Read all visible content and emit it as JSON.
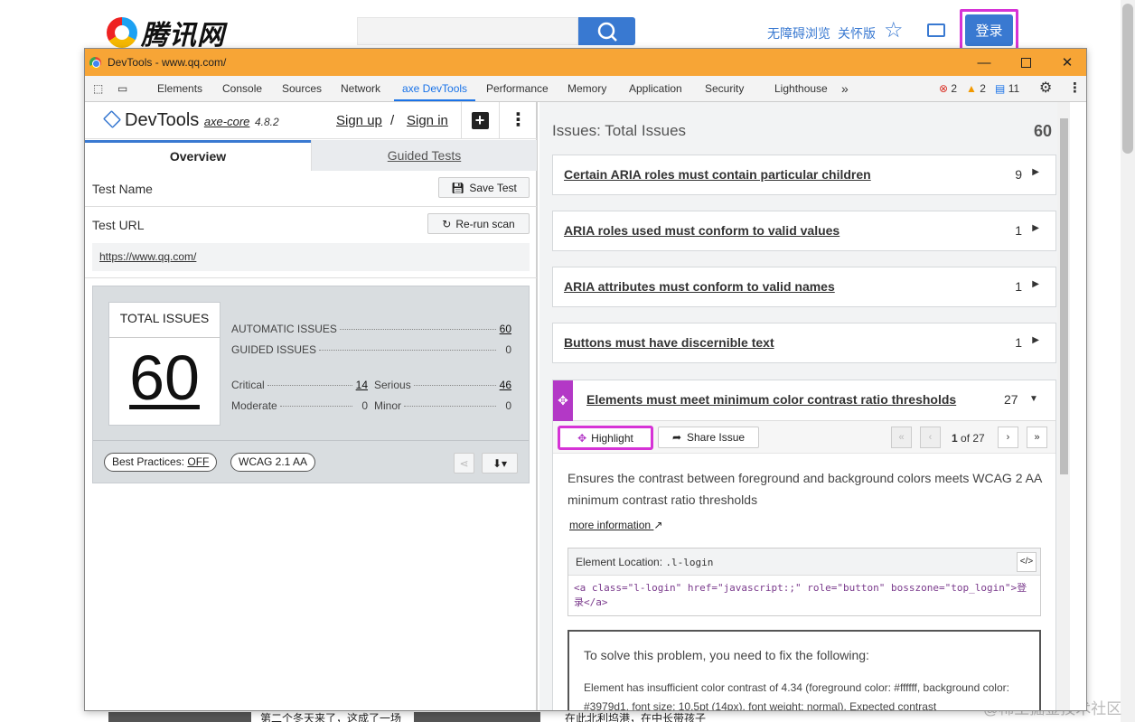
{
  "site": {
    "logo_text": "腾讯网",
    "links": [
      "无障碍浏览",
      "关怀版"
    ],
    "login_label": "登录",
    "bottom_news": [
      "第二个冬天来了，这成了一场",
      "在此北利坞港，在中长带孩子"
    ],
    "watermark": "@稀土掘金技术社区"
  },
  "devtools": {
    "window_title": "DevTools - www.qq.com/",
    "tabs": [
      "Elements",
      "Console",
      "Sources",
      "Network",
      "axe DevTools",
      "Performance",
      "Memory",
      "Application",
      "Security",
      "Lighthouse",
      "»"
    ],
    "active_tab": "axe DevTools",
    "errors": "2",
    "warnings": "2",
    "messages": "11"
  },
  "axe": {
    "brand": "DevTools",
    "core": "axe-core",
    "version": "4.8.2",
    "sign_up": "Sign up",
    "sign_sep": "/",
    "sign_in": "Sign in",
    "tab_overview": "Overview",
    "tab_guided": "Guided Tests",
    "test_name_label": "Test Name",
    "save_test": "Save Test",
    "test_url_label": "Test URL",
    "rerun_scan": "Re-run scan",
    "url": "https://www.qq.com/",
    "total_issues_label": "TOTAL ISSUES",
    "total_issues": "60",
    "automatic_label": "AUTOMATIC ISSUES",
    "automatic": "60",
    "guided_label": "GUIDED ISSUES",
    "guided": "0",
    "critical_label": "Critical",
    "critical": "14",
    "serious_label": "Serious",
    "serious": "46",
    "moderate_label": "Moderate",
    "moderate": "0",
    "minor_label": "Minor",
    "minor": "0",
    "best_practices": "Best Practices: ",
    "best_practices_value": "OFF",
    "wcag": "WCAG 2.1 AA"
  },
  "issues": {
    "title": "Issues: Total Issues",
    "count": "60",
    "list": [
      {
        "title": "Certain ARIA roles must contain particular children",
        "count": "9"
      },
      {
        "title": "ARIA roles used must conform to valid values",
        "count": "1"
      },
      {
        "title": "ARIA attributes must conform to valid names",
        "count": "1"
      },
      {
        "title": "Buttons must have discernible text",
        "count": "1"
      }
    ],
    "expanded": {
      "title": "Elements must meet minimum color contrast ratio thresholds",
      "count": "27",
      "highlight": "Highlight",
      "share_issue": "Share Issue",
      "page_current": "1",
      "page_of": "of 27",
      "description": "Ensures the contrast between foreground and background colors meets WCAG 2 AA minimum contrast ratio thresholds",
      "more_info": "more information",
      "location_label": "Element Location:",
      "location_selector": ".l-login",
      "code": "<a class=\"l-login\" href=\"javascript:;\" role=\"button\" bosszone=\"top_login\">登录</a>",
      "fix_title": "To solve this problem, you need to fix the following:",
      "fix_text": "Element has insufficient color contrast of 4.34 (foreground color: #ffffff, background color: #3979d1, font size: 10.5pt (14px), font weight: normal). Expected contrast"
    }
  },
  "colors": {
    "accent": "#3979d1",
    "highlight": "#d633d6",
    "titlebar": "#f7a536",
    "issue_icon": "#b338c6"
  }
}
